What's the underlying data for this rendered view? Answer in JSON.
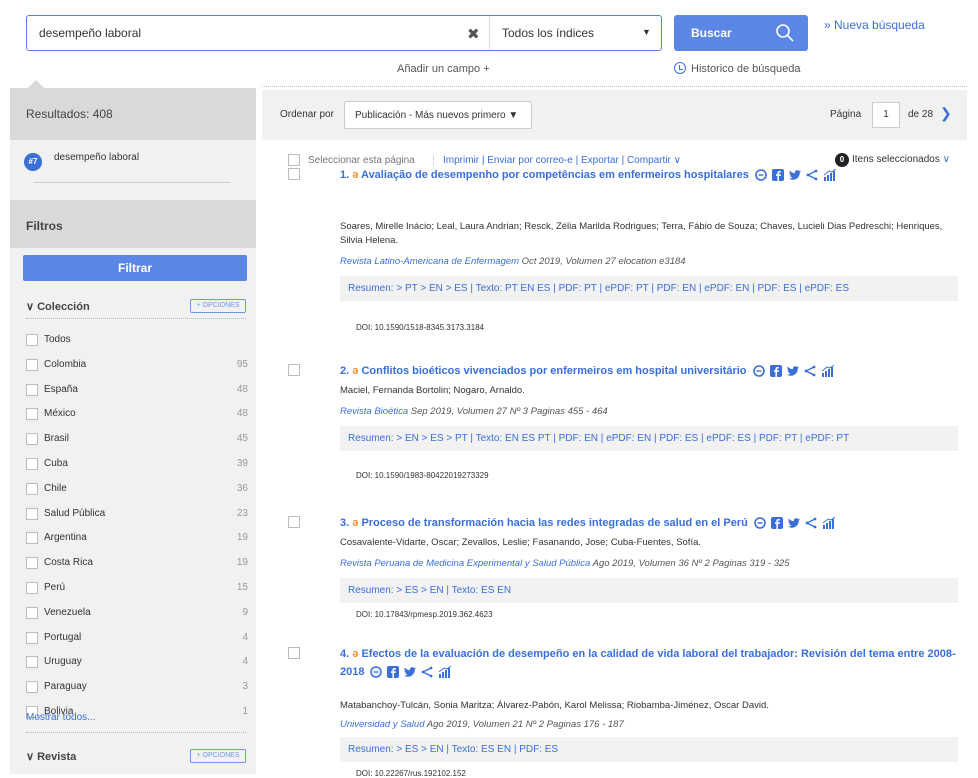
{
  "search": {
    "query": "desempeño laboral",
    "index": "Todos los índices",
    "button": "Buscar",
    "new_search": "» Nueva búsqueda",
    "add_field": "Añadir un campo +",
    "history": "Historico de búsqueda"
  },
  "sidebar": {
    "results": "Resultados: 408",
    "query_badge": "#7",
    "query_text": "desempeño laboral",
    "filters": "Filtros",
    "filter_button": "Filtrar",
    "options": "+ OPCIONES",
    "coleccion": {
      "label": "Colección",
      "items": [
        {
          "label": "Todos",
          "count": ""
        },
        {
          "label": "Colombia",
          "count": "95"
        },
        {
          "label": "España",
          "count": "48"
        },
        {
          "label": "México",
          "count": "48"
        },
        {
          "label": "Brasil",
          "count": "45"
        },
        {
          "label": "Cuba",
          "count": "39"
        },
        {
          "label": "Chile",
          "count": "36"
        },
        {
          "label": "Salud Pública",
          "count": "23"
        },
        {
          "label": "Argentina",
          "count": "19"
        },
        {
          "label": "Costa Rica",
          "count": "19"
        },
        {
          "label": "Perú",
          "count": "15"
        },
        {
          "label": "Venezuela",
          "count": "9"
        },
        {
          "label": "Portugal",
          "count": "4"
        },
        {
          "label": "Uruguay",
          "count": "4"
        },
        {
          "label": "Paraguay",
          "count": "3"
        },
        {
          "label": "Bolivia",
          "count": "1"
        }
      ]
    },
    "show_all": "Mostrar todos...",
    "revista": {
      "label": "Revista"
    }
  },
  "sortbar": {
    "order_label": "Ordenar por",
    "order_value": "Publicación - Más nuevos primero",
    "page_label": "Página",
    "page": "1",
    "of": "de 28"
  },
  "actions": {
    "select_page": "Seleccionar esta página",
    "links": "Imprimir | Enviar por correo-e | Exportar | Compartir",
    "selected_count": "0",
    "selected_label": "Itens seleccionados"
  },
  "results": [
    {
      "num": "1.",
      "title": "Avaliação de desempenho por competências em enfermeiros hospitalares",
      "authors": "Soares, Mirelle Inácio; Leal, Laura Andrian; Resck, Zélia Marilda Rodrigues; Terra, Fábio de Souza; Chaves, Lucieli Dias Pedreschi; Henriques, Silvia Helena.",
      "journal": "Revista Latino-Americana de Enfermagem",
      "source": "Oct 2019, Volumen 27    elocation e3184",
      "links": "Resumen: > PT  > EN  > ES  |  Texto: PT  EN  ES  |  PDF: PT  |  ePDF: PT  |  PDF: EN  |  ePDF: EN  |  PDF: ES  |  ePDF: ES",
      "doi": "DOI: 10.1590/1518-8345.3173.3184"
    },
    {
      "num": "2.",
      "title": "Conflitos bioéticos vivenciados por enfermeiros em hospital universitário",
      "authors": "Maciel, Fernanda Bortolin; Nogaro, Arnaldo.",
      "journal": "Revista Bioética",
      "source": "Sep 2019, Volumen 27    Nº 3    Paginas 455 - 464",
      "links": "Resumen: > EN  > ES  > PT  |  Texto: EN  ES  PT  |  PDF: EN  |  ePDF: EN  |  PDF: ES  |  ePDF: ES  |  PDF: PT  |  ePDF: PT",
      "doi": "DOI: 10.1590/1983-80422019273329"
    },
    {
      "num": "3.",
      "title": "Proceso de transformación hacia las redes integradas de salud en el Perú",
      "authors": "Cosavalente-Vidarte, Oscar; Zevallos, Leslie; Fasanando, Jose; Cuba-Fuentes, Sofía.",
      "journal": "Revista Peruana de Medicina Experimental y Salud Pública",
      "source": "Ago 2019, Volumen 36    Nº 2    Paginas 319 - 325",
      "links": "Resumen: > ES  > EN  |  Texto: ES  EN",
      "doi": "DOI: 10.17843/rpmesp.2019.362.4623"
    },
    {
      "num": "4.",
      "title": "Efectos de la evaluación de desempeño en la calidad de vida laboral del trabajador: Revisión del tema entre 2008-2018",
      "authors": "Matabanchoy-Tulcán, Sonia Maritza; Álvarez-Pabón, Karol Melissa; Riobamba-Jiménez, Oscar David.",
      "journal": "Universidad y Salud",
      "source": "Ago 2019, Volumen 21    Nº 2    Paginas 176 - 187",
      "links": "Resumen: > ES  > EN  |  Texto: ES  EN  |  PDF: ES",
      "doi": "DOI: 10.22267/rus.192102.152"
    }
  ],
  "colors": {
    "accent": "#5b86e5",
    "link": "#3a6fd8",
    "oa": "#f08a24",
    "sidebar_bg": "#f1f1f1",
    "sidebar_head": "#d9d9d9"
  },
  "icons": [
    "clear-icon",
    "caret-down-icon",
    "search-icon",
    "history-icon",
    "chevron-right-icon",
    "chevron-down-icon",
    "open-access-icon",
    "comment-icon",
    "facebook-icon",
    "twitter-icon",
    "share-icon",
    "metrics-icon"
  ]
}
